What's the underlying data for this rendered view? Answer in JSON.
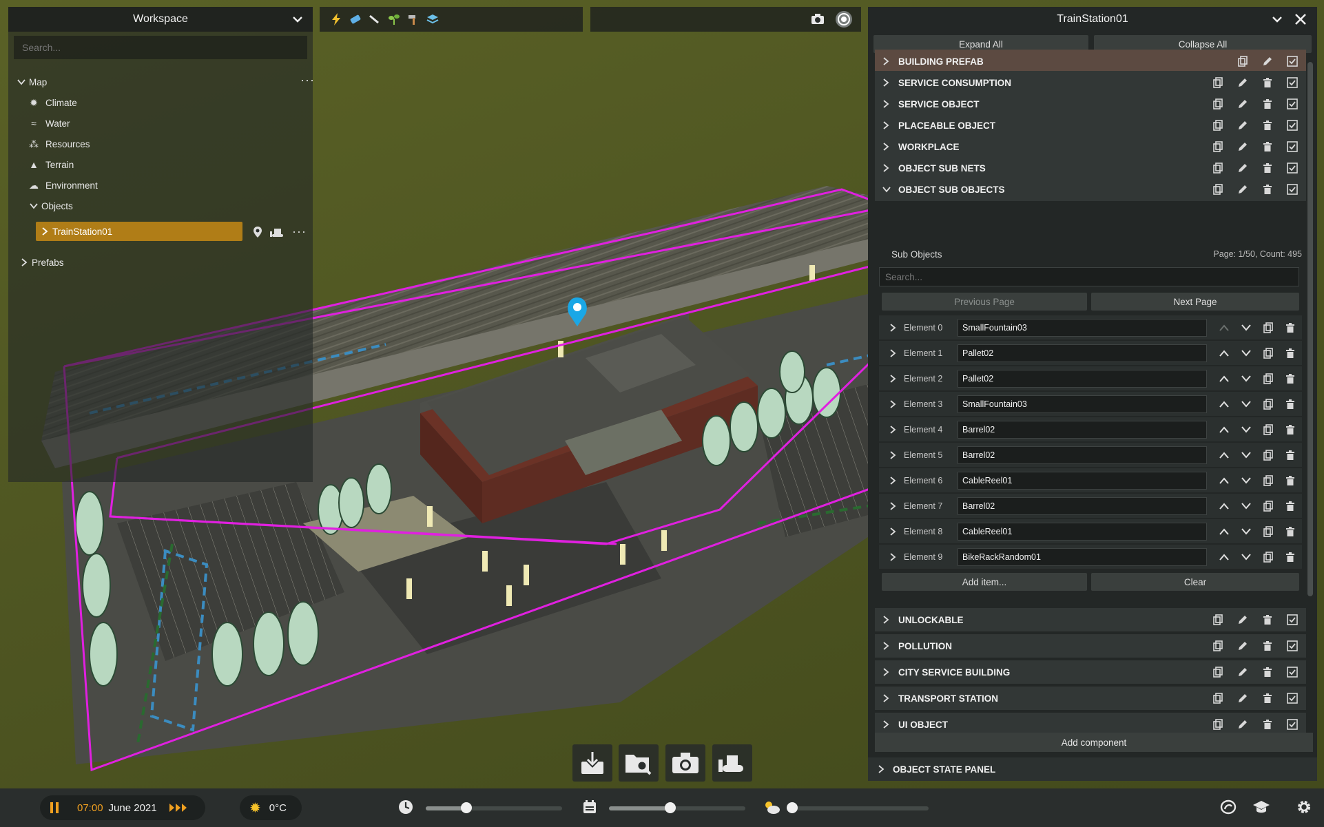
{
  "workspace": {
    "title": "Workspace",
    "search_placeholder": "Search...",
    "tree": {
      "map": "Map",
      "climate": "Climate",
      "water": "Water",
      "resources": "Resources",
      "terrain": "Terrain",
      "environment": "Environment",
      "objects": "Objects",
      "selected_object": "TrainStation01",
      "prefabs": "Prefabs"
    },
    "more": "···"
  },
  "inspector": {
    "title": "TrainStation01",
    "expand_all": "Expand All",
    "collapse_all": "Collapse All",
    "components": [
      {
        "label": "BUILDING PREFAB"
      },
      {
        "label": "SERVICE CONSUMPTION"
      },
      {
        "label": "SERVICE OBJECT"
      },
      {
        "label": "PLACEABLE OBJECT"
      },
      {
        "label": "WORKPLACE"
      },
      {
        "label": "OBJECT SUB NETS"
      },
      {
        "label": "OBJECT SUB OBJECTS"
      }
    ],
    "sub_objects": {
      "title": "Sub Objects",
      "page_info": "Page: 1/50, Count: 495",
      "search_placeholder": "Search...",
      "prev_page": "Previous Page",
      "next_page": "Next Page",
      "elements": [
        {
          "label": "Element 0",
          "value": "SmallFountain03"
        },
        {
          "label": "Element 1",
          "value": "Pallet02"
        },
        {
          "label": "Element 2",
          "value": "Pallet02"
        },
        {
          "label": "Element 3",
          "value": "SmallFountain03"
        },
        {
          "label": "Element 4",
          "value": "Barrel02"
        },
        {
          "label": "Element 5",
          "value": "Barrel02"
        },
        {
          "label": "Element 6",
          "value": "CableReel01"
        },
        {
          "label": "Element 7",
          "value": "Barrel02"
        },
        {
          "label": "Element 8",
          "value": "CableReel01"
        },
        {
          "label": "Element 9",
          "value": "BikeRackRandom01"
        }
      ],
      "add_item": "Add item...",
      "clear": "Clear"
    },
    "components_after": [
      {
        "label": "UNLOCKABLE"
      },
      {
        "label": "POLLUTION"
      },
      {
        "label": "CITY SERVICE BUILDING"
      },
      {
        "label": "TRANSPORT STATION"
      },
      {
        "label": "UI OBJECT"
      }
    ],
    "add_component": "Add component",
    "object_state_panel": "OBJECT STATE PANEL"
  },
  "bottom_bar": {
    "time": "07:00",
    "date": "June 2021",
    "temperature": "0°C",
    "sim_speed_position": 0.3,
    "date_position": 0.45,
    "weather_position": 0.0
  },
  "colors": {
    "accent": "#b07d17",
    "selection_outline": "#e020e0",
    "marker": "#1aa7e6",
    "time_text": "#f0a020"
  }
}
